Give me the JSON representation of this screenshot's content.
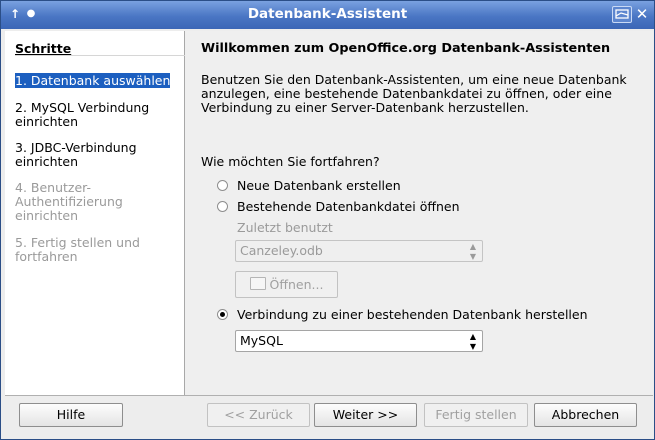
{
  "window": {
    "title": "Datenbank-Assistent"
  },
  "sidebar": {
    "title": "Schritte",
    "steps": [
      {
        "label": "1. Datenbank auswählen",
        "state": "active"
      },
      {
        "label": "2. MySQL Verbindung einrichten",
        "state": "enabled"
      },
      {
        "label": "3. JDBC-Verbindung einrichten",
        "state": "enabled"
      },
      {
        "label": "4. Benutzer-Authentifizierung einrichten",
        "state": "disabled"
      },
      {
        "label": "5. Fertig stellen und fortfahren",
        "state": "disabled"
      }
    ]
  },
  "main": {
    "heading": "Willkommen zum OpenOffice.org Datenbank-Assistenten",
    "description": "Benutzen Sie den Datenbank-Assistenten, um eine neue Datenbank anzulegen, eine bestehende Datenbankdatei zu öffnen, oder eine Verbindung zu einer Server-Datenbank herzustellen.",
    "question": "Wie möchten Sie fortfahren?",
    "options": {
      "new_db": "Neue Datenbank erstellen",
      "open_existing": "Bestehende Datenbankdatei öffnen",
      "recent_label": "Zuletzt benutzt",
      "recent_value": "Canzeley.odb",
      "open_button": "Öffnen...",
      "connect": "Verbindung zu einer bestehenden Datenbank herstellen",
      "connection_type": "MySQL"
    },
    "selected_option": "connect"
  },
  "footer": {
    "help": "Hilfe",
    "back": "<< Zurück",
    "next": "Weiter >>",
    "finish": "Fertig stellen",
    "cancel": "Abbrechen"
  },
  "colors": {
    "titlebar": "#4a76c4",
    "selection": "#1c5fc0"
  }
}
